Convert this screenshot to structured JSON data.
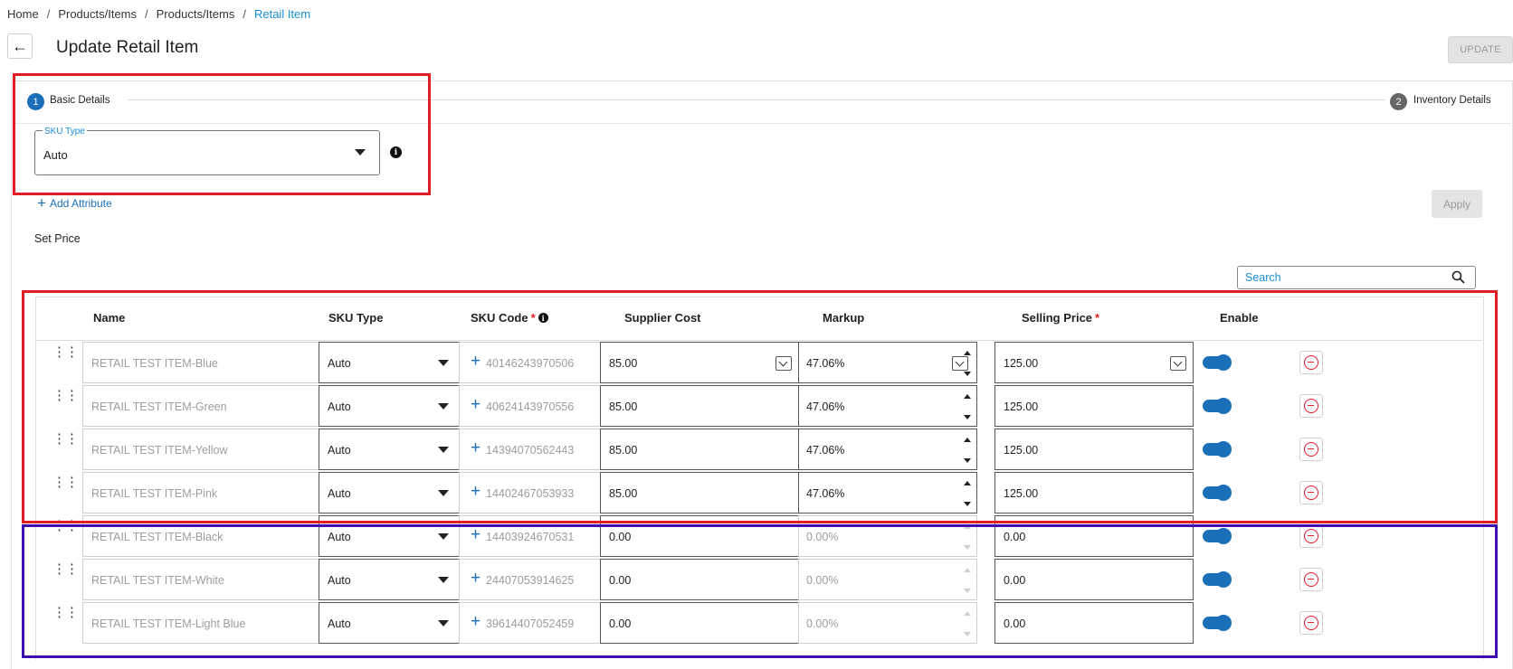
{
  "breadcrumb": [
    "Home",
    "Products/Items",
    "Products/Items",
    "Retail Item"
  ],
  "page": {
    "title": "Update Retail Item",
    "update_label": "UPDATE"
  },
  "stepper": {
    "step1": {
      "num": "1",
      "label": "Basic Details"
    },
    "step2": {
      "num": "2",
      "label": "Inventory Details"
    }
  },
  "sku_type": {
    "legend": "SKU Type",
    "value": "Auto"
  },
  "add_attribute_label": "Add Attribute",
  "apply_label": "Apply",
  "set_price_label": "Set Price",
  "search": {
    "placeholder": "Search"
  },
  "table": {
    "headers": {
      "name": "Name",
      "sku_type": "SKU Type",
      "sku_code": "SKU Code",
      "supplier_cost": "Supplier Cost",
      "markup": "Markup",
      "selling_price": "Selling Price",
      "enable": "Enable"
    },
    "rows": [
      {
        "name": "RETAIL TEST ITEM-Blue",
        "sku_type": "Auto",
        "sku_code": "40146243970506",
        "supplier_cost": "85.00",
        "markup": "47.06%",
        "selling_price": "125.00",
        "enabled": true
      },
      {
        "name": "RETAIL TEST ITEM-Green",
        "sku_type": "Auto",
        "sku_code": "40624143970556",
        "supplier_cost": "85.00",
        "markup": "47.06%",
        "selling_price": "125.00",
        "enabled": true
      },
      {
        "name": "RETAIL TEST ITEM-Yellow",
        "sku_type": "Auto",
        "sku_code": "14394070562443",
        "supplier_cost": "85.00",
        "markup": "47.06%",
        "selling_price": "125.00",
        "enabled": true
      },
      {
        "name": "RETAIL TEST ITEM-Pink",
        "sku_type": "Auto",
        "sku_code": "14402467053933",
        "supplier_cost": "85.00",
        "markup": "47.06%",
        "selling_price": "125.00",
        "enabled": true
      },
      {
        "name": "RETAIL TEST ITEM-Black",
        "sku_type": "Auto",
        "sku_code": "14403924670531",
        "supplier_cost": "0.00",
        "markup": "0.00%",
        "selling_price": "0.00",
        "enabled": true
      },
      {
        "name": "RETAIL TEST ITEM-White",
        "sku_type": "Auto",
        "sku_code": "24407053914625",
        "supplier_cost": "0.00",
        "markup": "0.00%",
        "selling_price": "0.00",
        "enabled": true
      },
      {
        "name": "RETAIL TEST ITEM-Light Blue",
        "sku_type": "Auto",
        "sku_code": "39614407052459",
        "supplier_cost": "0.00",
        "markup": "0.00%",
        "selling_price": "0.00",
        "enabled": true
      }
    ]
  },
  "colors": {
    "accent": "#1a6fb8",
    "link": "#1a8fd6",
    "highlight_red": "#e21d25",
    "highlight_blue": "#3d0fb0"
  }
}
